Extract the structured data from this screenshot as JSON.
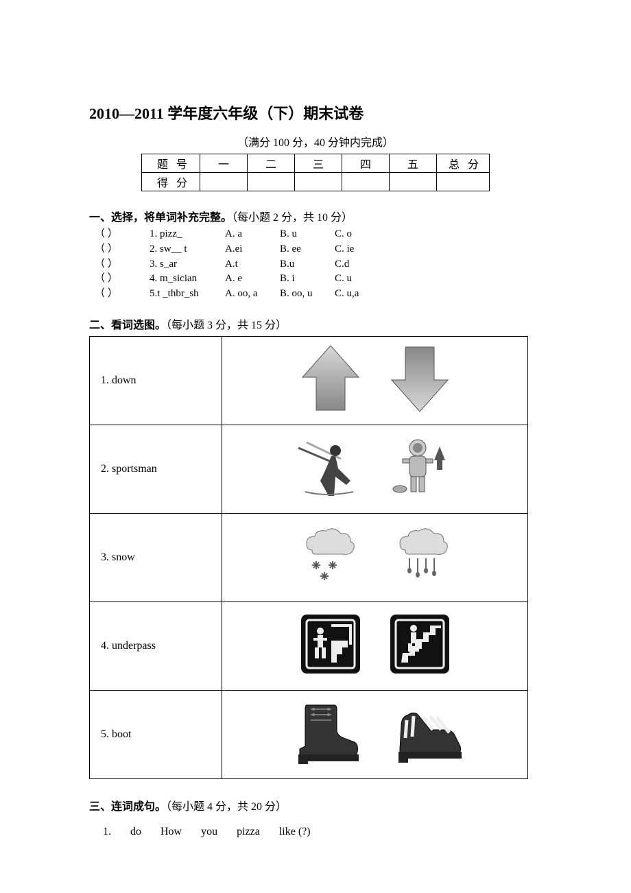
{
  "title": "2010—2011 学年度六年级（下）期末试卷",
  "subtitle": "（满分 100 分，40 分钟内完成）",
  "score_table": {
    "row1_label": "题号",
    "row2_label": "得分",
    "cols": [
      "一",
      "二",
      "三",
      "四",
      "五"
    ],
    "total_label": "总分"
  },
  "section1": {
    "heading_bold": "一、选择，将单词补充完整。",
    "heading_rest": "（每小题 2 分，共 10 分）",
    "rows": [
      {
        "paren": "（    ）",
        "word": "1. pizz_",
        "a": "A. a",
        "b": "B. u",
        "c": "C. o"
      },
      {
        "paren": "（    ）",
        "word": "2. sw__ t",
        "a": "A.ei",
        "b": "B. ee",
        "c": "C. ie"
      },
      {
        "paren": "（    ）",
        "word": "3. s_ar",
        "a": "A.t",
        "b": "B.u",
        "c": "C.d"
      },
      {
        "paren": "（    ）",
        "word": "4. m_sician",
        "a": "A. e",
        "b": "B. i",
        "c": "C. u"
      },
      {
        "paren": "（    ）",
        "word": "5.t _thbr_sh",
        "a": "A. oo, a",
        "b": "B. oo, u",
        "c": "C. u,a"
      }
    ]
  },
  "section2": {
    "heading_bold": "二、看词选图。",
    "heading_rest": "（每小题 3 分，共 15 分）",
    "rows": [
      {
        "word": "1. down"
      },
      {
        "word": "2. sportsman"
      },
      {
        "word": "3. snow"
      },
      {
        "word": "4. underpass"
      },
      {
        "word": "5. boot"
      }
    ]
  },
  "section3": {
    "heading_bold": "三、连词成句。",
    "heading_rest": "（每小题 4 分，共 20 分）",
    "q1": {
      "n": "1.",
      "w1": "do",
      "w2": "How",
      "w3": "you",
      "w4": "pizza",
      "w5": "like (?)"
    }
  }
}
